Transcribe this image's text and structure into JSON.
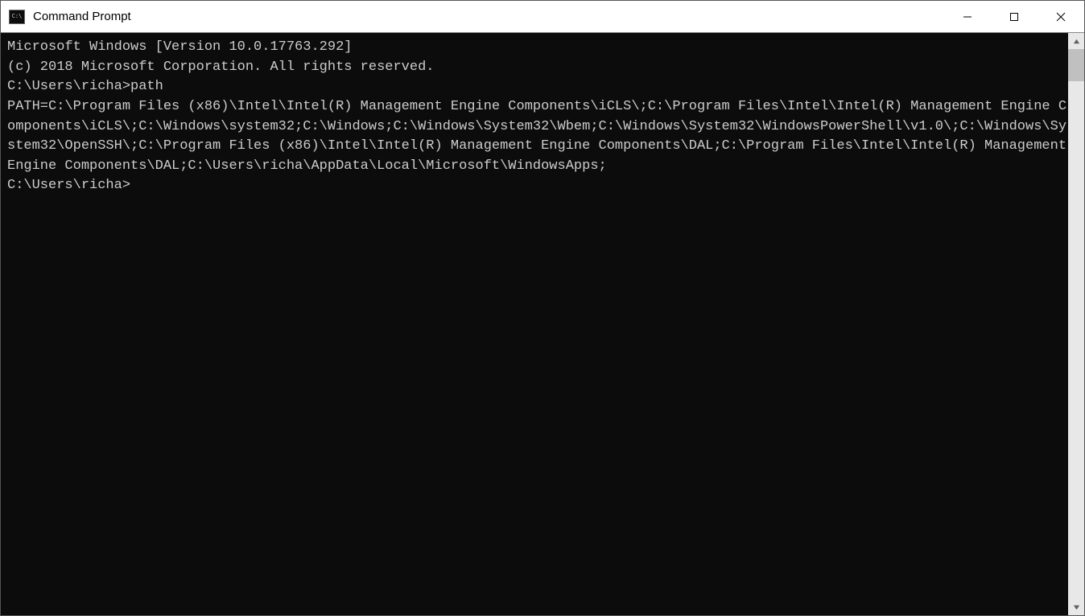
{
  "titlebar": {
    "title": "Command Prompt"
  },
  "terminal": {
    "line1": "Microsoft Windows [Version 10.0.17763.292]",
    "line2": "(c) 2018 Microsoft Corporation. All rights reserved.",
    "blank1": "",
    "prompt1": "C:\\Users\\richa>path",
    "path_output": "PATH=C:\\Program Files (x86)\\Intel\\Intel(R) Management Engine Components\\iCLS\\;C:\\Program Files\\Intel\\Intel(R) Management Engine Components\\iCLS\\;C:\\Windows\\system32;C:\\Windows;C:\\Windows\\System32\\Wbem;C:\\Windows\\System32\\WindowsPowerShell\\v1.0\\;C:\\Windows\\System32\\OpenSSH\\;C:\\Program Files (x86)\\Intel\\Intel(R) Management Engine Components\\DAL;C:\\Program Files\\Intel\\Intel(R) Management Engine Components\\DAL;C:\\Users\\richa\\AppData\\Local\\Microsoft\\WindowsApps;",
    "blank2": "",
    "prompt2": "C:\\Users\\richa>"
  }
}
